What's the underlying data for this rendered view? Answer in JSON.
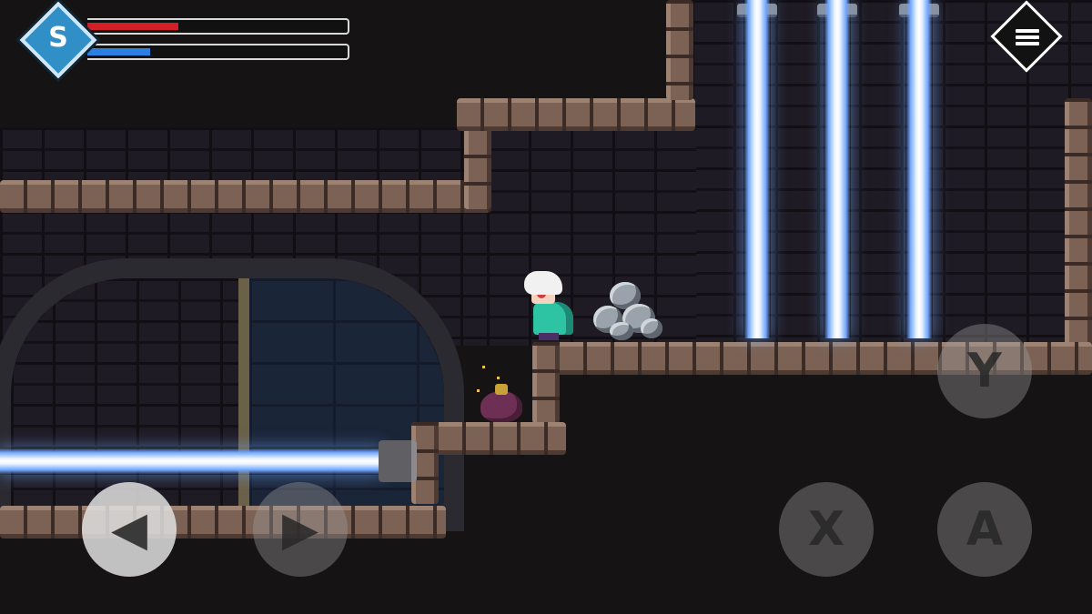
{
  "hud": {
    "emblem_glyph": "S",
    "emblem_icon": "emblem-s-icon",
    "health_fraction": 0.35,
    "mana_fraction": 0.24,
    "health_color": "#d21f26",
    "mana_color": "#2b7fe0"
  },
  "menu": {
    "icon": "hamburger-menu-icon"
  },
  "controls": {
    "y_label": "Y",
    "x_label": "X",
    "a_label": "A",
    "left_label": "◀",
    "right_label": "▶"
  },
  "colors": {
    "laser": "#e9f2ff",
    "laser_glow": "#6fa7ff",
    "stone": "#7b6254"
  }
}
